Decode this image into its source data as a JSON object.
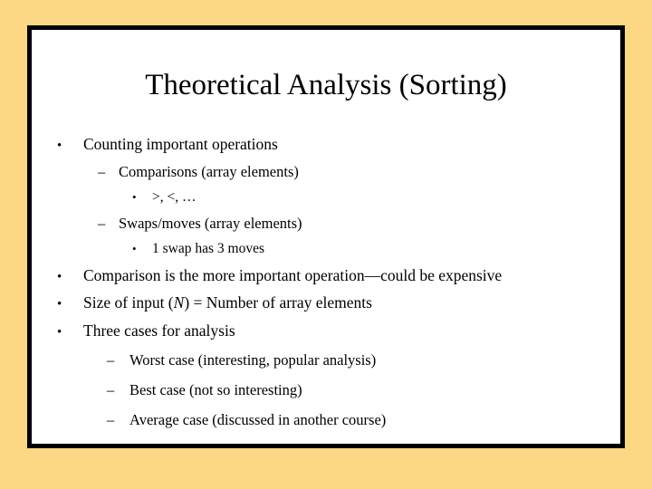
{
  "slide": {
    "title": "Theoretical Analysis (Sorting)",
    "background_color": "#fcd884",
    "frame_color": "#000000",
    "content_color": "#ffffff",
    "text_color": "#000000",
    "bullets": [
      {
        "level": 1,
        "marker": "•",
        "text": "Counting important operations"
      },
      {
        "level": 2,
        "marker": "–",
        "text": "Comparisons (array elements)"
      },
      {
        "level": 3,
        "marker": "•",
        "text": ">, <, …"
      },
      {
        "level": 2,
        "marker": "–",
        "text": "Swaps/moves (array elements)"
      },
      {
        "level": 3,
        "marker": "•",
        "text": "1 swap has 3 moves"
      },
      {
        "level": 1,
        "marker": "•",
        "text": "Comparison is the more important operation—could be expensive"
      },
      {
        "level": 1,
        "marker": "•",
        "text_before_variable": "Size of input (",
        "variable": "N",
        "text_after_variable": ") = Number of array elements"
      },
      {
        "level": 1,
        "marker": "•",
        "text": "Three cases for analysis"
      },
      {
        "level": 2,
        "marker": "–",
        "text": "Worst case (interesting, popular analysis)"
      },
      {
        "level": 2,
        "marker": "–",
        "text": "Best case (not so interesting)"
      },
      {
        "level": 2,
        "marker": "–",
        "text": "Average case (discussed in another course)"
      }
    ]
  }
}
